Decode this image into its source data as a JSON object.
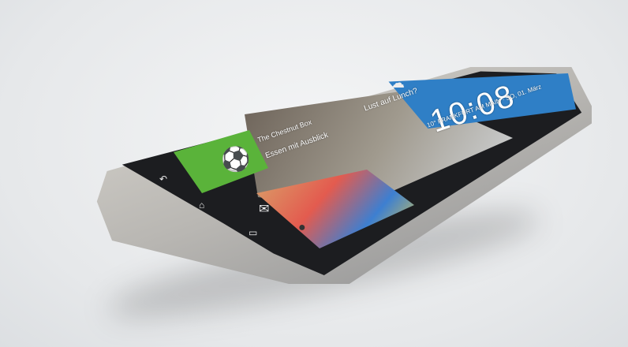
{
  "screen": {
    "clock": "10:08",
    "location_date": "10° FRANKFURT AM MAIN · SO, 01. März",
    "banner": "Lust auf Lunch?",
    "restaurant": "The Chestnut Box",
    "headline": "Essen mit Ausblick"
  },
  "icons": [
    "weather-cloud-sun-icon",
    "back-icon",
    "home-icon",
    "recent-apps-icon",
    "mail-icon",
    "camera-icon",
    "soccer-ball-icon"
  ],
  "colors": {
    "weather_tile": "#2f7fc6",
    "green_tile": "#5ab33a",
    "body": "#b8b6b2"
  }
}
